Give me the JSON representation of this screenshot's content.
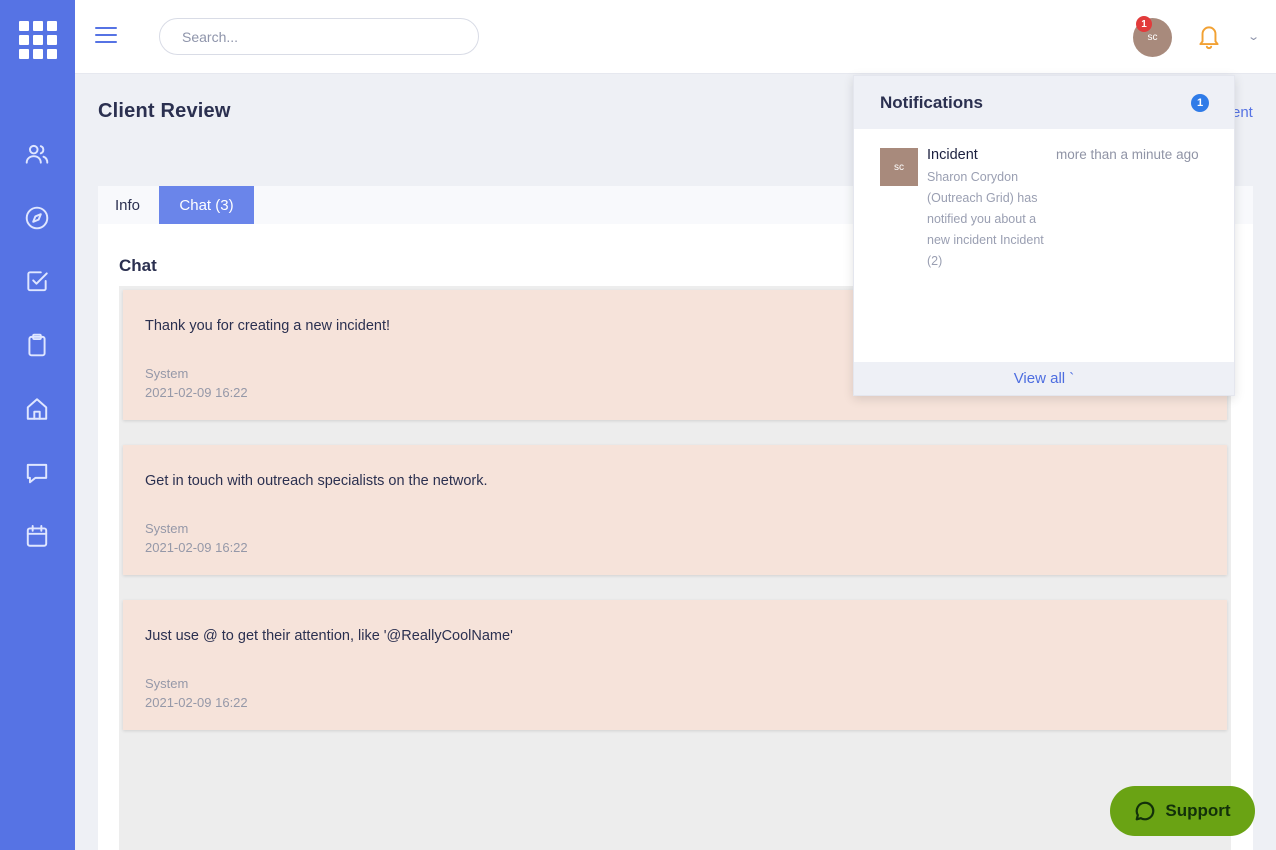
{
  "header": {
    "search_placeholder": "Search...",
    "user_initials": "sc",
    "notification_badge": "1"
  },
  "sidebar": {
    "items": [
      {
        "icon": "users-icon"
      },
      {
        "icon": "compass-icon"
      },
      {
        "icon": "checkbox-icon"
      },
      {
        "icon": "clipboard-icon"
      },
      {
        "icon": "home-icon"
      },
      {
        "icon": "chat-icon"
      },
      {
        "icon": "calendar-icon"
      }
    ]
  },
  "page": {
    "title": "Client Review",
    "action_fragment": "ent"
  },
  "tabs": [
    {
      "label": "Info",
      "active": false
    },
    {
      "label": "Chat (3)",
      "active": true
    }
  ],
  "chat": {
    "title": "Chat",
    "messages": [
      {
        "text": "Thank you for creating a new incident!",
        "author": "System",
        "time": "2021-02-09 16:22"
      },
      {
        "text": "Get in touch with outreach specialists on the network.",
        "author": "System",
        "time": "2021-02-09 16:22"
      },
      {
        "text": "Just use @ to get their attention, like '@ReallyCoolName'",
        "author": "System",
        "time": "2021-02-09 16:22"
      }
    ]
  },
  "notifications": {
    "title": "Notifications",
    "count": "1",
    "items": [
      {
        "avatar": "sc",
        "title": "Incident",
        "time": "more than a minute ago",
        "body": "Sharon Corydon (Outreach Grid) has notified you about a new incident Incident (2)"
      }
    ],
    "view_all": "View all `"
  },
  "support": {
    "label": "Support"
  },
  "colors": {
    "sidebar": "#5673e4",
    "accent": "#5673e4",
    "message_bg": "#f6e3da",
    "support_bg": "#6aa314",
    "badge_red": "#e23b3b"
  }
}
